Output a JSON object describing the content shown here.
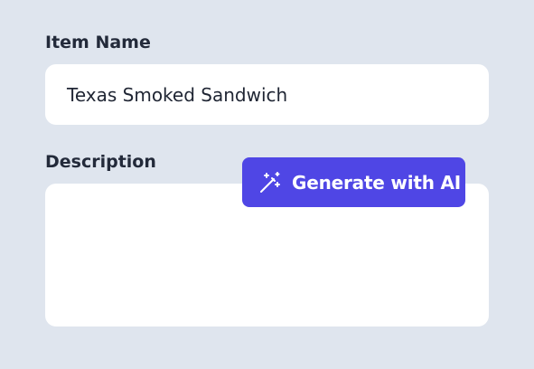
{
  "form": {
    "item_name": {
      "label": "Item Name",
      "value": "Texas Smoked Sandwich"
    },
    "description": {
      "label": "Description",
      "value": ""
    },
    "generate_button": {
      "label": "Generate with AI",
      "icon": "magic-wand-icon"
    }
  },
  "colors": {
    "background": "#dfe5ee",
    "field": "#ffffff",
    "accent": "#4f46e5",
    "label_text": "#232a3a"
  }
}
